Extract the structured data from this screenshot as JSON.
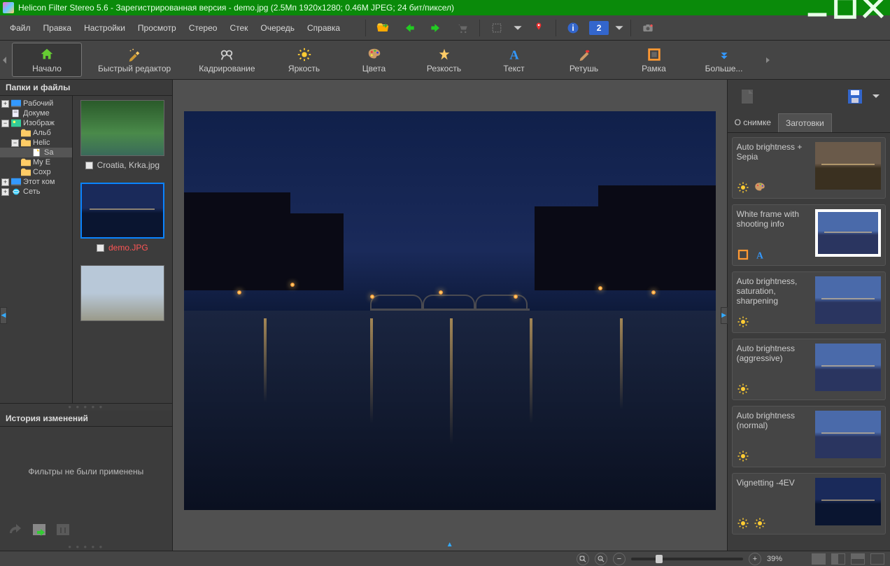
{
  "title": "Helicon Filter Stereo 5.6 - Зарегистрированная версия - demo.jpg (2.5Мп 1920x1280; 0.46M JPEG; 24 бит/пиксел)",
  "menu": {
    "file": "Файл",
    "edit": "Правка",
    "settings": "Настройки",
    "view": "Просмотр",
    "stereo": "Стерео",
    "stack": "Стек",
    "queue": "Очередь",
    "help": "Справка"
  },
  "stereo_count": "2",
  "ribbon": {
    "start": "Начало",
    "quick": "Быстрый редактор",
    "crop": "Кадрирование",
    "brightness": "Яркость",
    "colors": "Цвета",
    "sharpness": "Резкость",
    "text": "Текст",
    "retouch": "Ретушь",
    "frame": "Рамка",
    "more": "Больше..."
  },
  "left": {
    "header": "Папки и файлы",
    "tree": {
      "desktop": "Рабочий",
      "documents": "Докуме",
      "images": "Изображ",
      "albums": "Альб",
      "helicon": "Helic",
      "sa": "Sa",
      "mye": "My E",
      "coxp": "Coxp",
      "thiscomp": "Этот ком",
      "network": "Сеть"
    },
    "thumbs": {
      "t1": "Croatia, Krka.jpg",
      "t2": "demo.JPG"
    },
    "history_header": "История изменений",
    "history_empty": "Фильтры не были применены"
  },
  "right": {
    "tab_about": "О снимке",
    "tab_presets": "Заготовки",
    "presets": [
      {
        "name": "Auto brightness + Sepia",
        "style": "sepia"
      },
      {
        "name": "White frame with shooting info",
        "style": "frame"
      },
      {
        "name": "Auto brightness, saturation, sharpening",
        "style": "day"
      },
      {
        "name": "Auto brightness (aggressive)",
        "style": "day"
      },
      {
        "name": "Auto brightness (normal)",
        "style": "day"
      },
      {
        "name": "Vignetting -4EV",
        "style": "night"
      }
    ]
  },
  "status": {
    "zoom": "39%"
  }
}
